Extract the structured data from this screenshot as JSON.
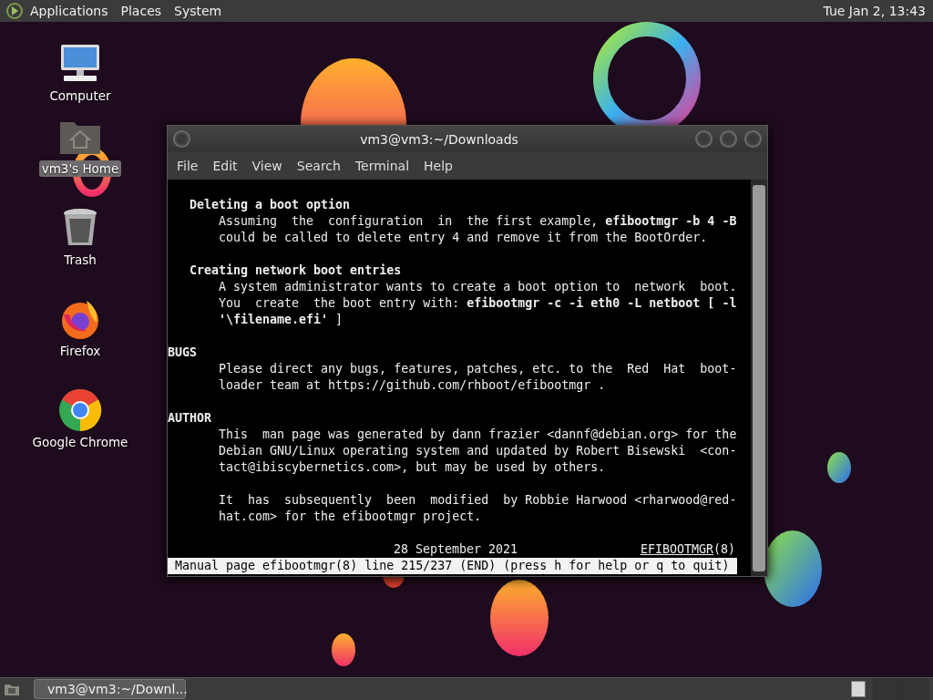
{
  "top_panel": {
    "menus": [
      "Applications",
      "Places",
      "System"
    ],
    "clock": "Tue Jan 2, 13:43"
  },
  "desktop_icons": [
    {
      "kind": "computer",
      "label": "Computer",
      "selected": false
    },
    {
      "kind": "home",
      "label": "vm3's Home",
      "selected": true
    },
    {
      "kind": "trash",
      "label": "Trash",
      "selected": false
    },
    {
      "kind": "firefox",
      "label": "Firefox",
      "selected": false
    },
    {
      "kind": "chrome",
      "label": "Google Chrome",
      "selected": false
    }
  ],
  "terminal": {
    "title": "vm3@vm3:~/Downloads",
    "menu": [
      "File",
      "Edit",
      "View",
      "Search",
      "Terminal",
      "Help"
    ],
    "blocks": [
      {
        "kind": "subheading",
        "lines": [
          "Deleting a boot option"
        ]
      },
      {
        "kind": "paragraph",
        "lines": [
          "Assuming  the  configuration  in  the first example, **efibootmgr -b 4 -B**",
          "could be called to delete entry 4 and remove it from the BootOrder."
        ]
      },
      {
        "kind": "subheading",
        "lines": [
          "Creating network boot entries"
        ]
      },
      {
        "kind": "paragraph",
        "lines": [
          "A system administrator wants to create a boot option to  network  boot.",
          "You  create  the boot entry with: **efibootmgr -c -i eth0 -L netboot [ -l**",
          "**'\\filename.efi'** ]"
        ]
      },
      {
        "kind": "heading",
        "lines": [
          "BUGS"
        ]
      },
      {
        "kind": "paragraph",
        "lines": [
          "Please direct any bugs, features, patches, etc. to the  Red  Hat  boot-",
          "loader team at https://github.com/rhboot/efibootmgr ."
        ]
      },
      {
        "kind": "heading",
        "lines": [
          "AUTHOR"
        ]
      },
      {
        "kind": "paragraph",
        "lines": [
          "This  man page was generated by dann frazier <dannf@debian.org> for the",
          "Debian GNU/Linux operating system and updated by Robert Bisewski  <con-",
          "tact@ibiscybernetics.com>, but may be used by others."
        ]
      },
      {
        "kind": "paragraph",
        "lines": [
          "It  has  subsequently  been  modified  by Robbie Harwood <rharwood@red-",
          "hat.com> for the efibootmgr project."
        ]
      }
    ],
    "footer": {
      "date": "28 September 2021",
      "title_underlined": "EFIBOOTMGR",
      "title_rest": "(8)"
    },
    "status": "Manual page efibootmgr(8) line 215/237 (END) (press h for help or q to quit)"
  },
  "taskbar": {
    "items": [
      {
        "label": "vm3@vm3:~/Downl...",
        "selected": false
      }
    ]
  }
}
